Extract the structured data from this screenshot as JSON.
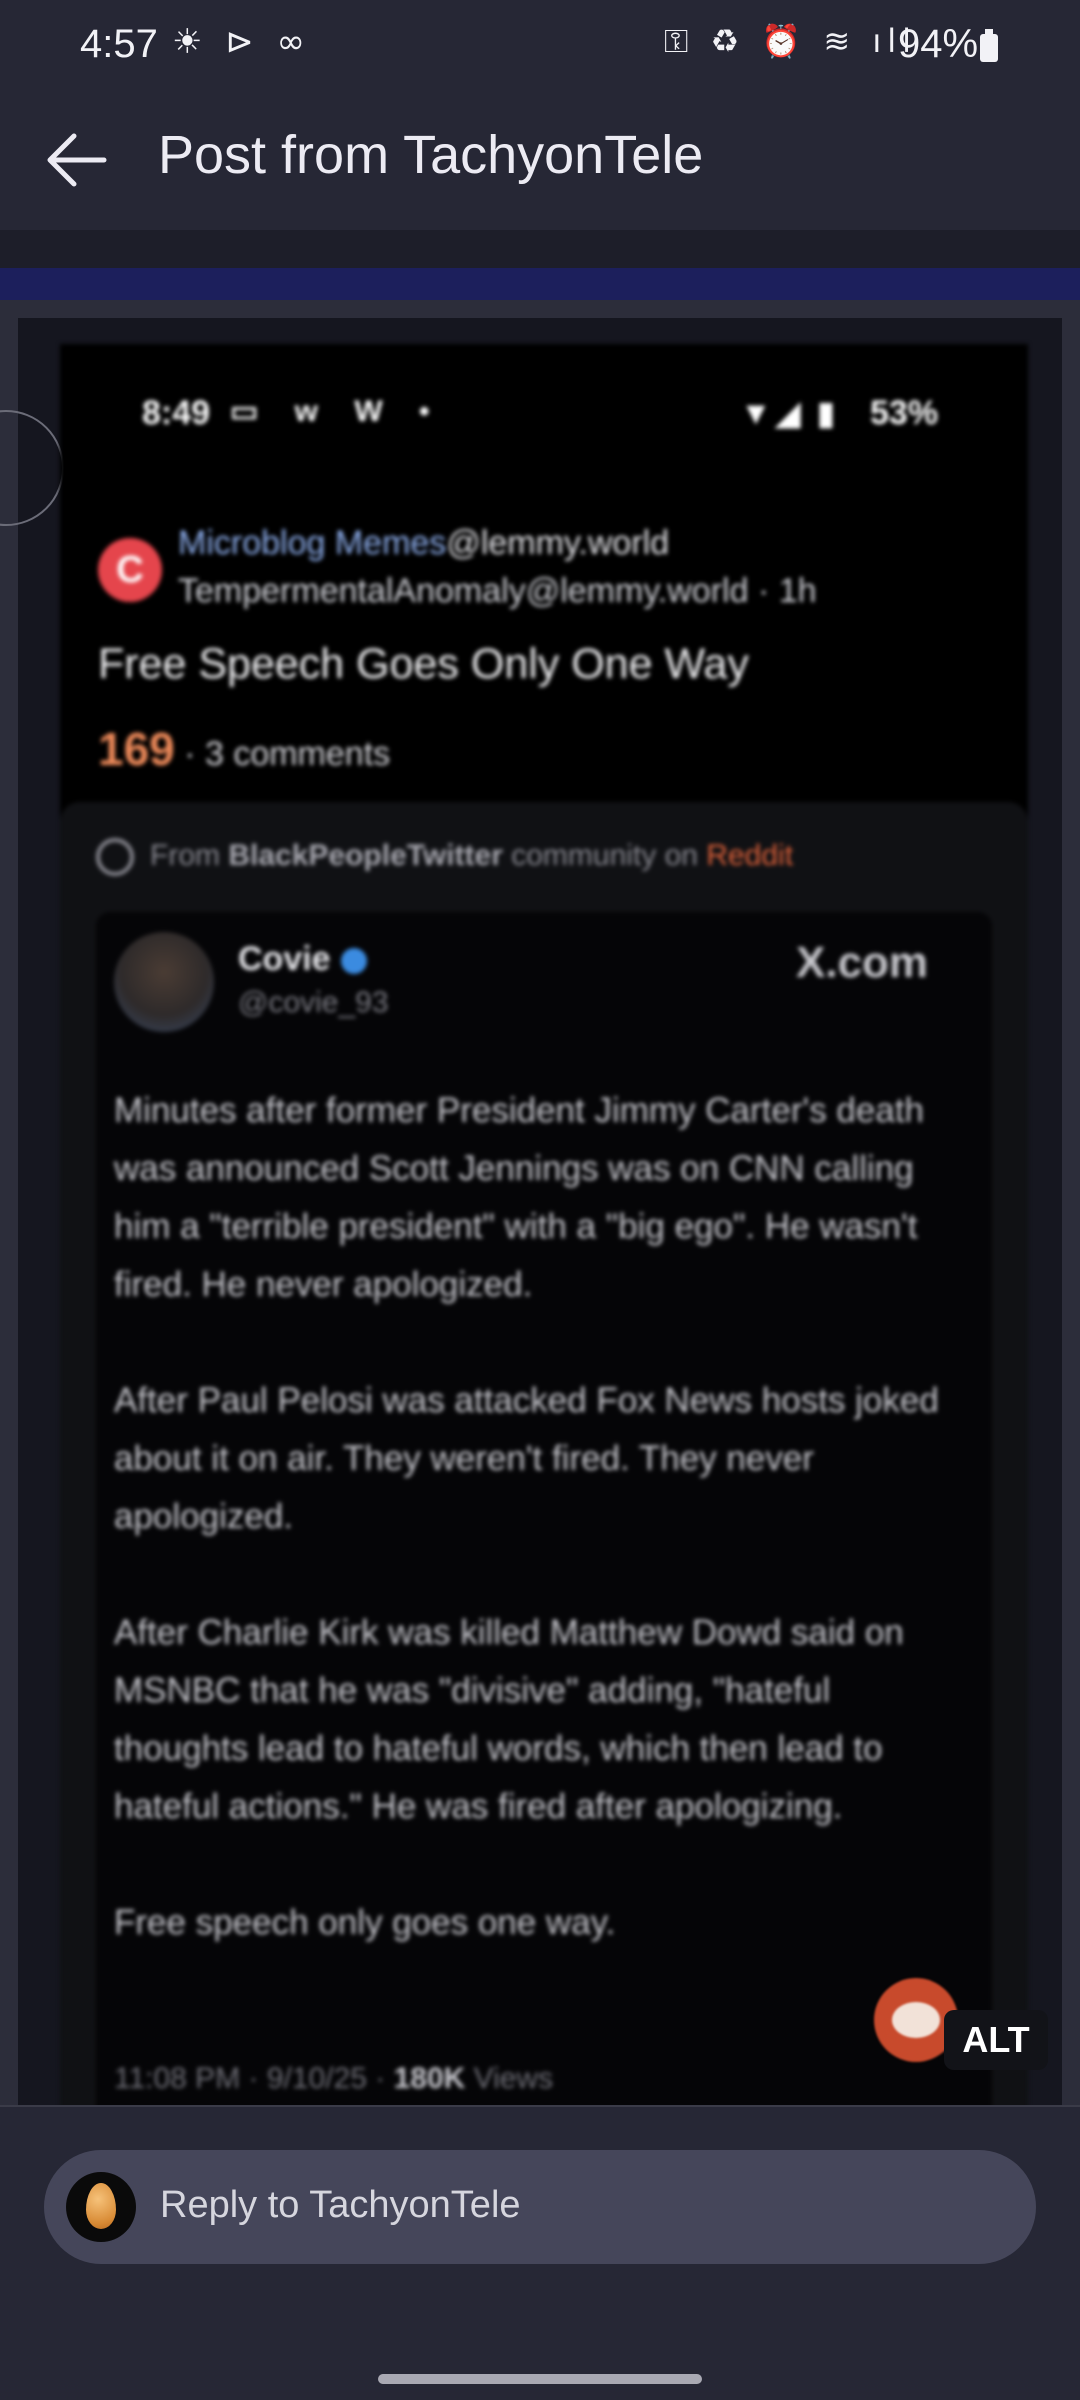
{
  "status_bar": {
    "time": "4:57",
    "left_icons": "☀ ⊳ ∞",
    "right_icons": "⚿ ♻ ⏰ ≋ ıll",
    "battery": "94%"
  },
  "app_bar": {
    "back_icon": "arrow-left-icon",
    "title": "Post from TachyonTele"
  },
  "image": {
    "alt_label": "ALT",
    "screenshot": {
      "status": {
        "time": "8:49",
        "icons": "▭ w W •",
        "right_icons": "▼◢ ▮",
        "battery": "53%"
      },
      "community_avatar_letter": "C",
      "community": "Microblog Memes",
      "community_instance": "@lemmy.world",
      "author_line": "TempermentalAnomaly@lemmy.world · 1h",
      "title": "Free Speech Goes Only One Way",
      "score": "169",
      "comments": "· 3 comments",
      "embed": {
        "prefix": "From",
        "community": "BlackPeopleTwitter",
        "middle": "community on",
        "source": "Reddit",
        "tweet": {
          "name": "Covie",
          "handle": "@covie_93",
          "site": "X.com",
          "paragraphs": [
            "Minutes after former President Jimmy Carter's death was announced Scott Jennings was on CNN calling him a \"terrible president\" with a \"big ego\". He wasn't fired. He never apologized.",
            "After Paul Pelosi was attacked Fox News hosts joked about it on air. They weren't fired. They never apologized.",
            "After Charlie Kirk was killed Matthew Dowd said on MSNBC that he was \"divisive\" adding, \"hateful thoughts lead to hateful words, which then lead to hateful actions.\" He was fired after apologizing.",
            "Free speech only goes one way."
          ],
          "footer_time": "11:08 PM · 9/10/25 ·",
          "views_count": "180K",
          "views_label": "Views"
        }
      }
    }
  },
  "reply": {
    "placeholder": "Reply to TachyonTele"
  }
}
